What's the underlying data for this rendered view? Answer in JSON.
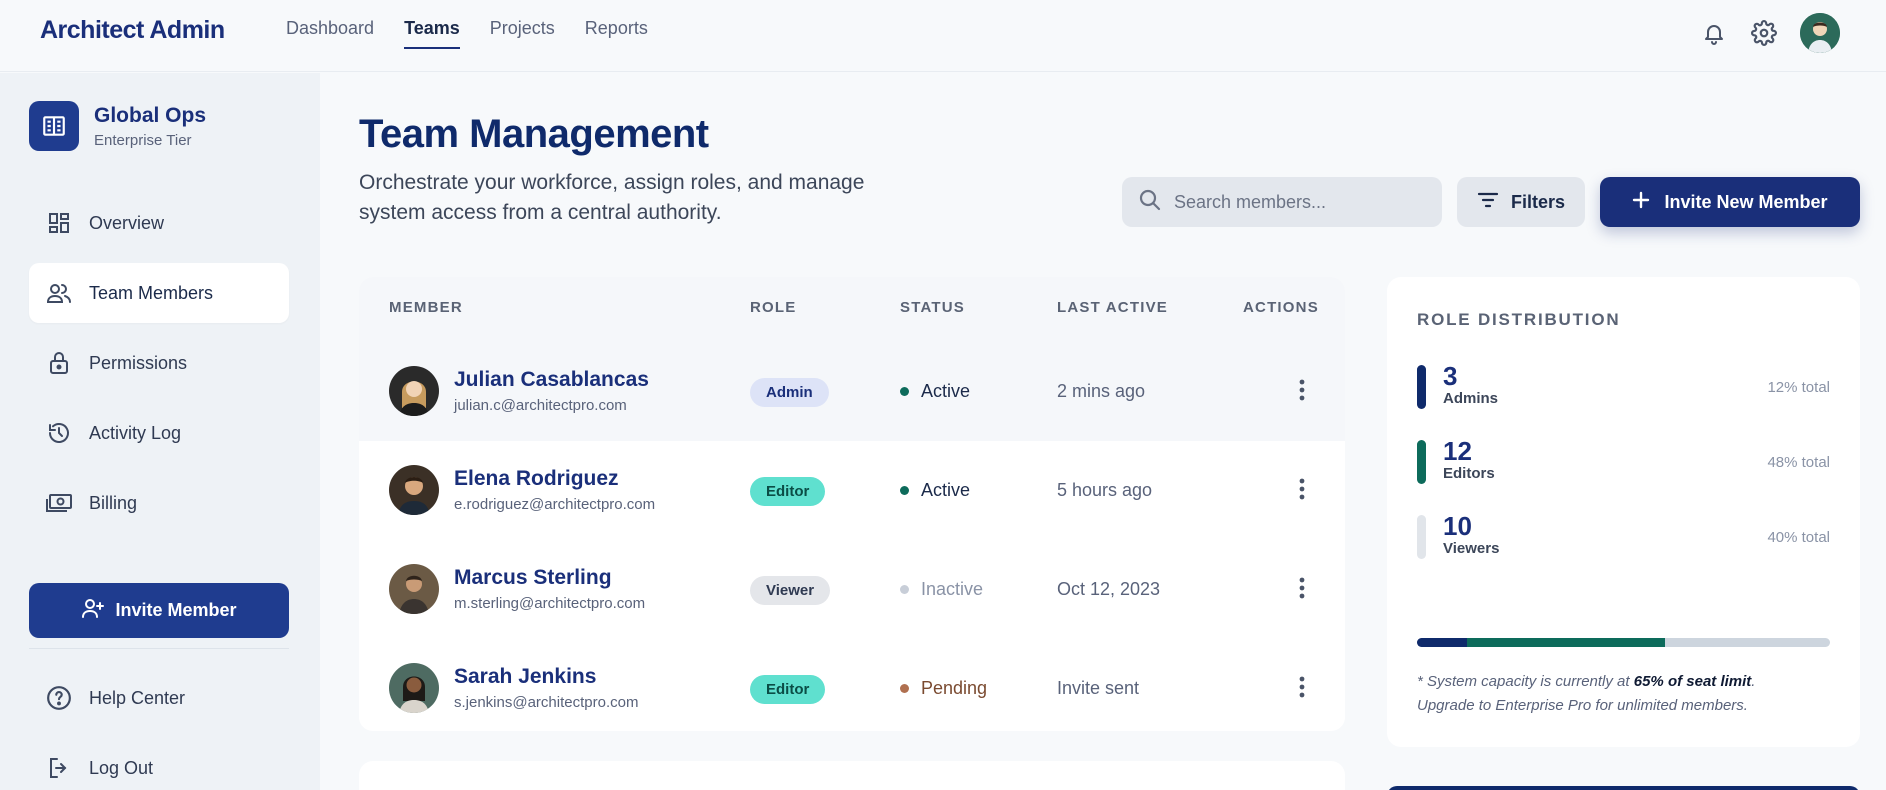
{
  "header": {
    "brand": "Architect Admin",
    "nav": [
      "Dashboard",
      "Teams",
      "Projects",
      "Reports"
    ],
    "active_nav": "Teams"
  },
  "sidebar": {
    "org_name": "Global Ops",
    "org_tier": "Enterprise Tier",
    "items": [
      {
        "label": "Overview",
        "icon": "dashboard-icon"
      },
      {
        "label": "Team Members",
        "icon": "users-icon"
      },
      {
        "label": "Permissions",
        "icon": "lock-icon"
      },
      {
        "label": "Activity Log",
        "icon": "history-icon"
      },
      {
        "label": "Billing",
        "icon": "billing-icon"
      }
    ],
    "active_item": "Team Members",
    "invite_label": "Invite Member",
    "bottom_items": [
      {
        "label": "Help Center",
        "icon": "help-icon"
      },
      {
        "label": "Log Out",
        "icon": "logout-icon"
      }
    ]
  },
  "main": {
    "title": "Team Management",
    "subtitle": "Orchestrate your workforce, assign roles, and manage system access from a central authority.",
    "search_placeholder": "Search members...",
    "filters_label": "Filters",
    "invite_label": "Invite New Member"
  },
  "table": {
    "columns": [
      "MEMBER",
      "ROLE",
      "STATUS",
      "LAST ACTIVE",
      "ACTIONS"
    ],
    "rows": [
      {
        "name": "Julian Casablancas",
        "email": "julian.c@architectpro.com",
        "role": "Admin",
        "status": "Active",
        "last_active": "2 mins ago"
      },
      {
        "name": "Elena Rodriguez",
        "email": "e.rodriguez@architectpro.com",
        "role": "Editor",
        "status": "Active",
        "last_active": "5 hours ago"
      },
      {
        "name": "Marcus Sterling",
        "email": "m.sterling@architectpro.com",
        "role": "Viewer",
        "status": "Inactive",
        "last_active": "Oct 12, 2023"
      },
      {
        "name": "Sarah Jenkins",
        "email": "s.jenkins@architectpro.com",
        "role": "Editor",
        "status": "Pending",
        "last_active": "Invite sent"
      }
    ]
  },
  "distribution": {
    "title": "ROLE DISTRIBUTION",
    "roles": [
      {
        "count": "3",
        "label": "Admins",
        "pct": "12% total",
        "color": "#0f2a6b"
      },
      {
        "count": "12",
        "label": "Editors",
        "pct": "48% total",
        "color": "#0d6b5b"
      },
      {
        "count": "10",
        "label": "Viewers",
        "pct": "40% total",
        "color": "#e1e5ea"
      }
    ],
    "capacity_segments": [
      {
        "fraction": 0.12,
        "color": "#0f2a6b"
      },
      {
        "fraction": 0.48,
        "color": "#0d6b5b"
      }
    ],
    "capacity_prefix": "* System capacity is currently at ",
    "capacity_value": "65% of seat limit",
    "capacity_suffix": ".",
    "capacity_line2": "Upgrade to Enterprise Pro for unlimited members."
  },
  "colors": {
    "primary": "#1a2f7a",
    "active": "#0d6b5b",
    "inactive": "#c8ced8",
    "pending": "#9a5b3a"
  }
}
